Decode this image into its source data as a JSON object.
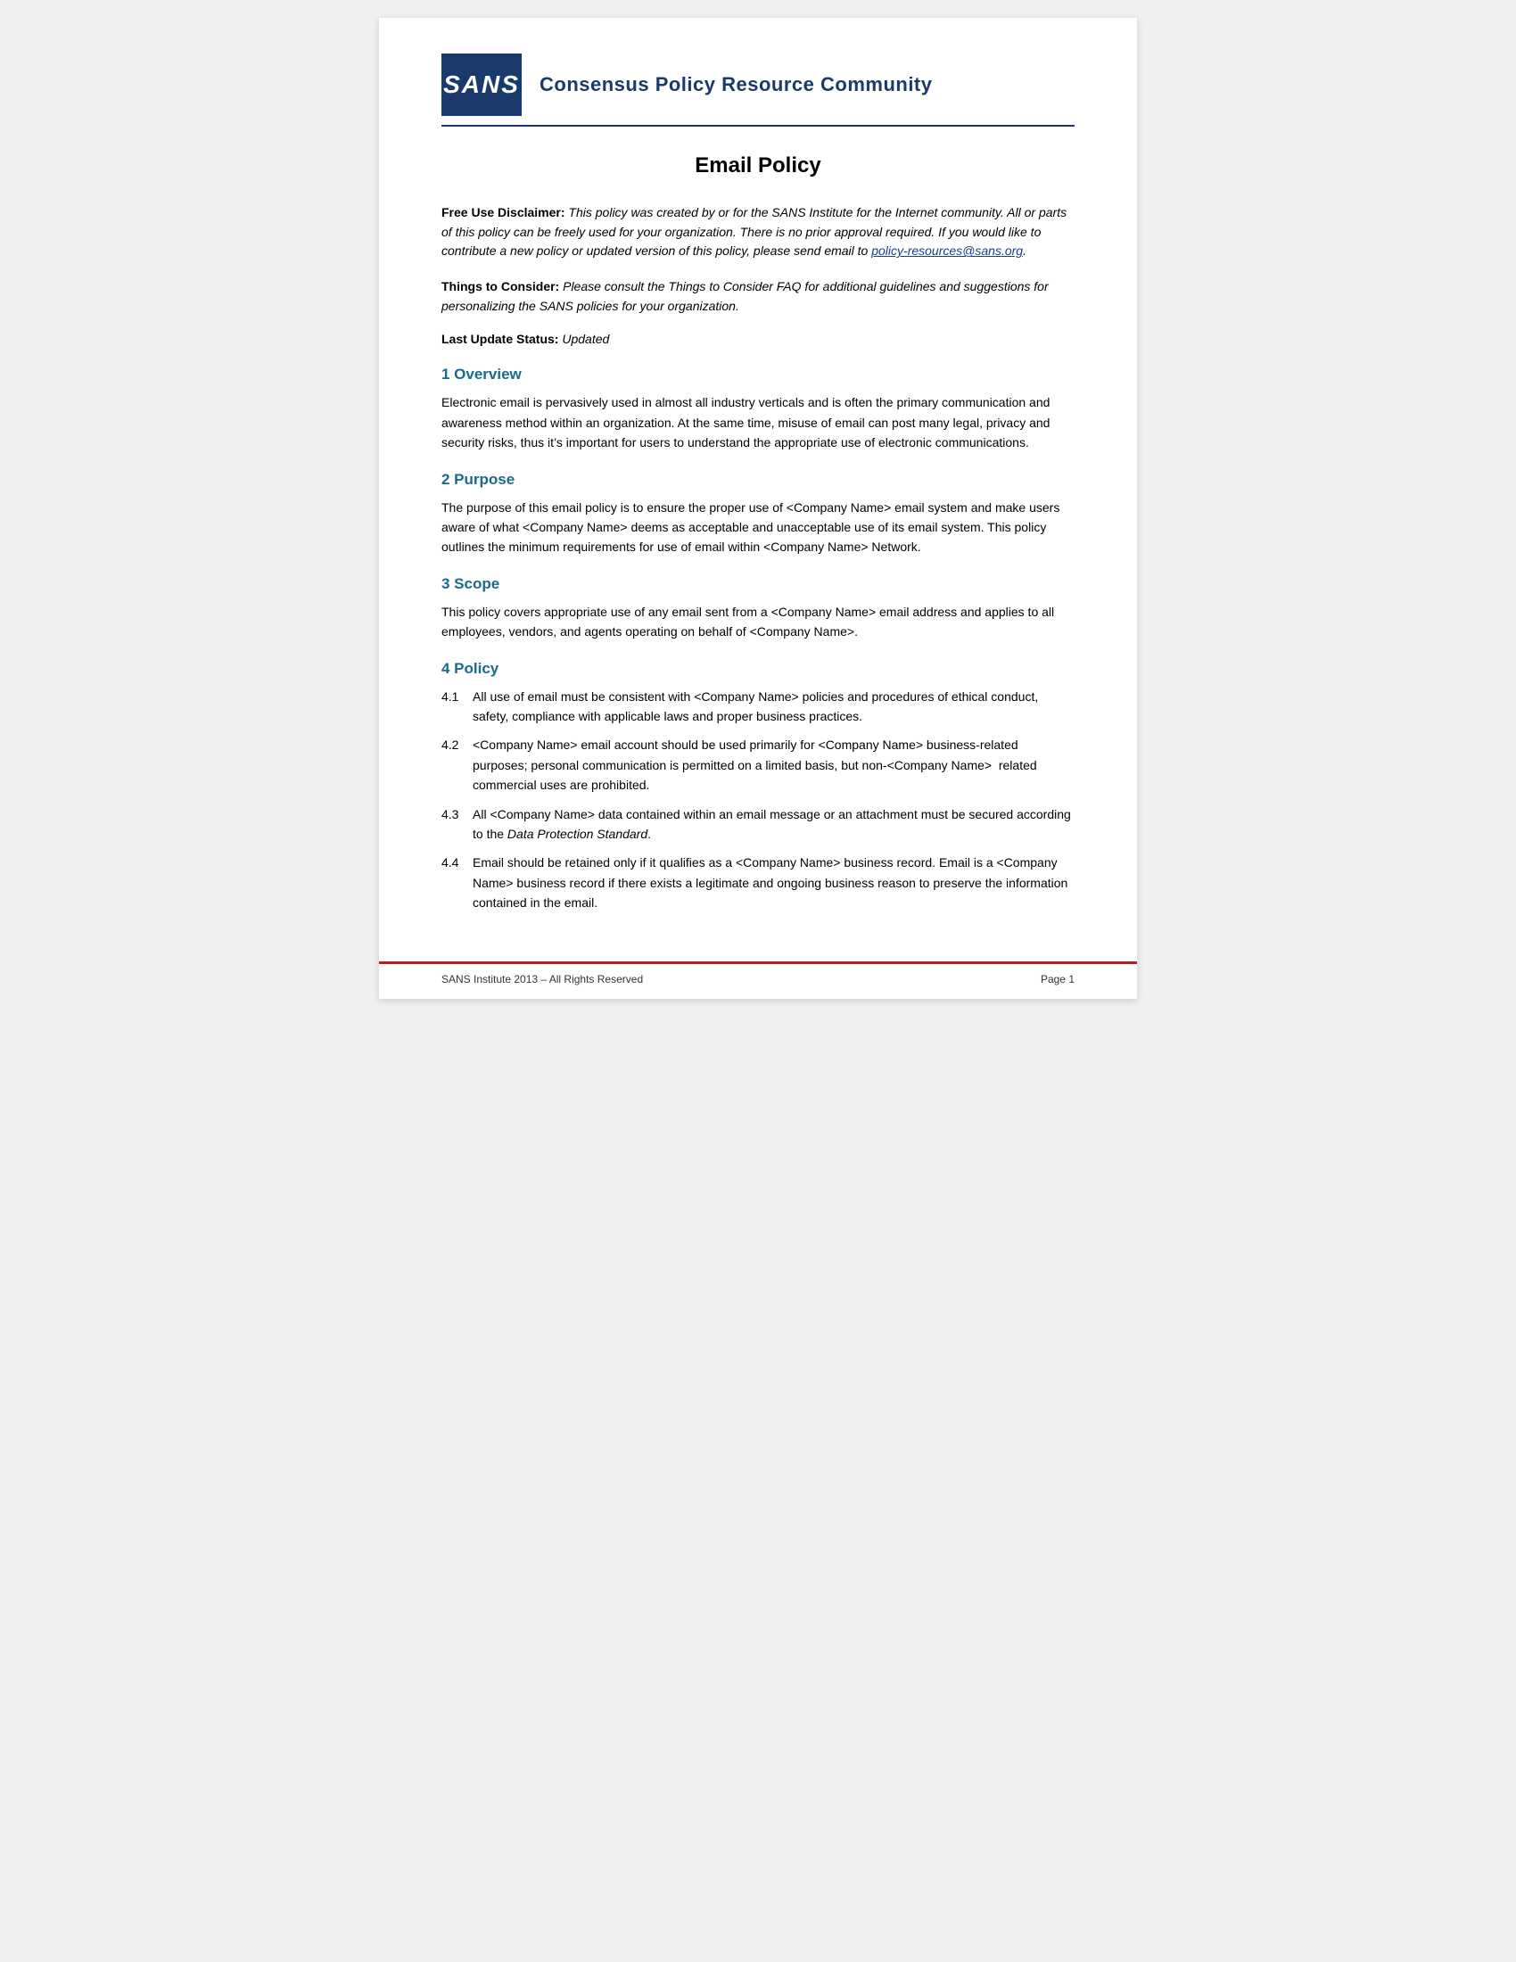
{
  "header": {
    "logo_text": "SANS",
    "title": "Consensus Policy Resource Community"
  },
  "document": {
    "title": "Email Policy",
    "disclaimer_label": "Free Use Disclaimer:",
    "disclaimer_text": "This policy was created by or for the SANS Institute for the Internet community. All or parts of this policy can be freely used for your organization. There is no prior approval required. If you would like to contribute a new policy or updated version of this policy, please send email to ",
    "disclaimer_link_text": "policy-resources@sans.org",
    "disclaimer_link_href": "mailto:policy-resources@sans.org",
    "disclaimer_end": ".",
    "things_label": "Things to Consider:",
    "things_text": "Please consult the Things to Consider FAQ for additional guidelines and suggestions for personalizing the SANS policies for your organization.",
    "last_update_label": "Last Update Status:",
    "last_update_value": "Updated"
  },
  "sections": [
    {
      "num": "1",
      "title": "Overview",
      "body": "Electronic email is pervasively used in almost all industry verticals and is often the primary communication and awareness method within an organization. At the same time, misuse of email can post many legal, privacy and security risks, thus it’s important for users to understand the appropriate use of electronic communications."
    },
    {
      "num": "2",
      "title": "Purpose",
      "body": "The purpose of this email policy is to ensure the proper use of <Company Name> email system and make users aware of what <Company Name> deems as acceptable and unacceptable use of its email system. This policy outlines the minimum requirements for use of email within <Company Name> Network."
    },
    {
      "num": "3",
      "title": "Scope",
      "body": "This policy covers appropriate use of any email sent from a <Company Name> email address and applies to all employees, vendors, and agents operating on behalf of <Company Name>."
    },
    {
      "num": "4",
      "title": "Policy",
      "body": null,
      "items": [
        {
          "num": "4.1",
          "text": "All use of email must be consistent with <Company Name> policies and procedures of ethical conduct, safety, compliance with applicable laws and proper business practices."
        },
        {
          "num": "4.2",
          "text": "<Company Name> email account should be used primarily for <Company Name> business-related purposes; personal communication is permitted on a limited basis, but non-<Company Name>   related commercial uses are prohibited."
        },
        {
          "num": "4.3",
          "text": "All <Company Name> data contained within an email message or an attachment must be secured according to the ",
          "text_italic": "Data Protection Standard",
          "text_after": "."
        },
        {
          "num": "4.4",
          "text": "Email should be retained only if it qualifies as a <Company Name> business record. Email is a <Company Name> business record if there exists a legitimate and ongoing business reason to preserve the information contained in the email."
        }
      ]
    }
  ],
  "footer": {
    "left": "SANS Institute 2013 – All Rights Reserved",
    "right": "Page 1"
  }
}
